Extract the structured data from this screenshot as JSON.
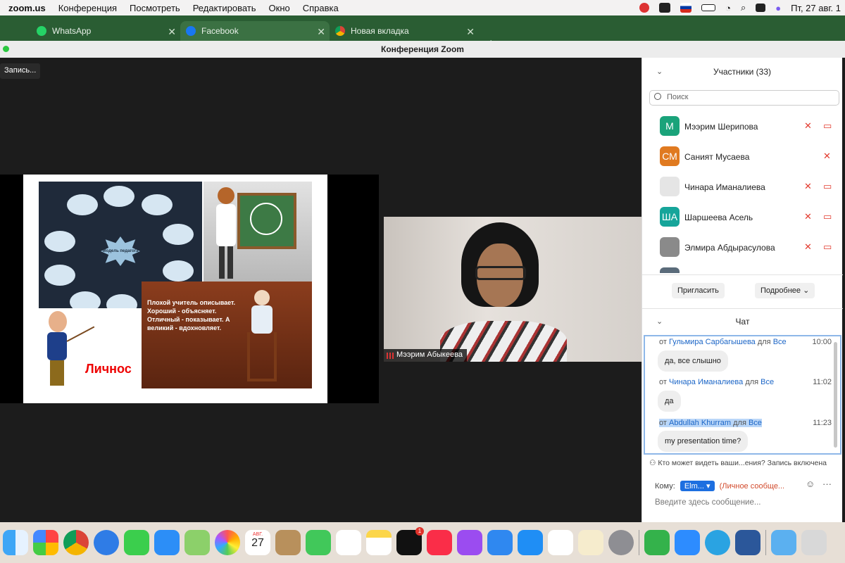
{
  "menubar": {
    "app": "zoom.us",
    "items": [
      "Конференция",
      "Посмотреть",
      "Редактировать",
      "Окно",
      "Справка"
    ],
    "datetime": "Пт, 27 авг. 1"
  },
  "browser": {
    "tabs": [
      {
        "label": "WhatsApp",
        "color": "#25d366"
      },
      {
        "label": "Facebook",
        "color": "#1877f2"
      },
      {
        "label": "Новая вкладка",
        "color": "#4285f4"
      }
    ]
  },
  "window": {
    "title": "Конференция Zoom"
  },
  "meeting": {
    "recording_label": "Запись...",
    "slide": {
      "center_text": "Модель педагога",
      "quote": "Плохой учитель описывает. Хороший - объясняет. Отличный - показывает. А великий - вдохновляет.",
      "bottom_word": "Личнос"
    },
    "camera": {
      "name": "Мээрим Абыкеева"
    }
  },
  "participants": {
    "header": "Участники (33)",
    "search_placeholder": "Поиск",
    "list": [
      {
        "initials": "М",
        "name": "Мээрим Шерипова",
        "color": "#1aa37a"
      },
      {
        "initials": "СМ",
        "name": "Саният Мусаева",
        "color": "#e07a20"
      },
      {
        "initials": "",
        "name": "Чинара Иманалиева",
        "color": "#e5e5e5"
      },
      {
        "initials": "ША",
        "name": "Шаршеева Асель",
        "color": "#16a59a"
      },
      {
        "initials": "",
        "name": "Элмира Абдырасулова",
        "color": "#8a8a8a"
      },
      {
        "initials": "",
        "name": "",
        "color": "#5a6b7a"
      }
    ],
    "invite": "Пригласить",
    "more": "Подробнее"
  },
  "chat": {
    "header": "Чат",
    "messages": [
      {
        "prefix": "от",
        "from": "Гульмира Сарбагышева",
        "mid": "для",
        "to": "Все",
        "time": "10:00",
        "text": "да, все слышно"
      },
      {
        "prefix": "от",
        "from": "Чинара Иманалиева",
        "mid": "для",
        "to": "Все",
        "time": "11:02",
        "text": "да"
      },
      {
        "prefix": "от",
        "from": "Abdullah Khurram",
        "mid": "для",
        "to": "Все",
        "time": "11:23",
        "text": "my presentation time?"
      }
    ],
    "visibility": "Кто может видеть ваши...ения? Запись включена",
    "to_label": "Кому:",
    "to_value": "Elm...",
    "private": "(Личное сообще...",
    "input_placeholder": "Введите здесь сообщение..."
  },
  "dock": {
    "calendar_month": "АВГ.",
    "calendar_day": "27",
    "tv_badge": "1"
  }
}
